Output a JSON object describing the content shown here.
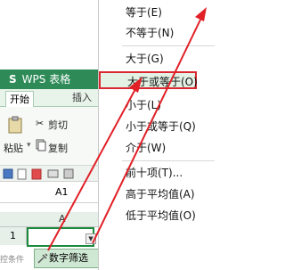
{
  "app": {
    "logo": "S",
    "title": "WPS 表格"
  },
  "tabs": {
    "start": "开始",
    "insert": "插入"
  },
  "ribbon": {
    "cut": "剪切",
    "paste": "粘贴",
    "copy": "复制"
  },
  "formula_bar": {
    "name_box": "A1"
  },
  "sheet": {
    "column": "A",
    "row": "1"
  },
  "status": {
    "left_text": "控条件"
  },
  "filter_button": {
    "label": "数字筛选"
  },
  "menu": {
    "items": [
      "等于(E)",
      "不等于(N)",
      "大于(G)",
      "大于或等于(O)",
      "小于(L)",
      "小于或等于(Q)",
      "介于(W)",
      "前十项(T)...",
      "高于平均值(A)",
      "低于平均值(O)"
    ],
    "highlighted": "大于或等于(O)"
  },
  "colors": {
    "accent_green": "#2e8b57",
    "highlight_red": "#d9282f"
  },
  "icons": [
    "scissors-icon",
    "paste-icon",
    "copy-icon",
    "filter-arrow-icon",
    "tools-icon"
  ]
}
